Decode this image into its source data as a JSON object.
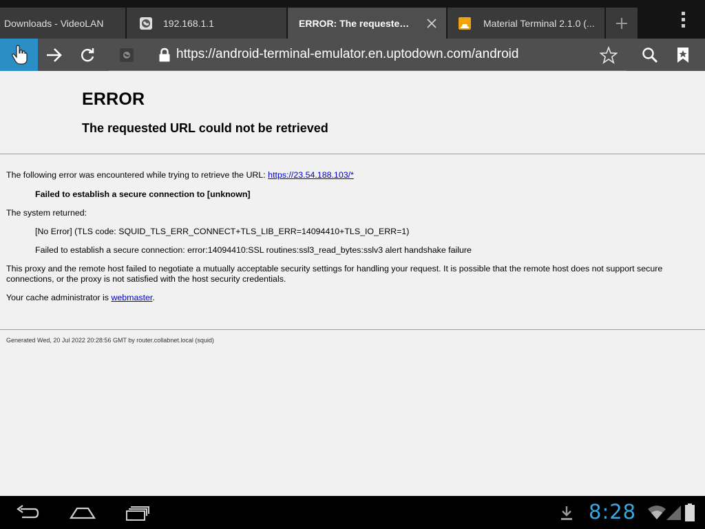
{
  "tabs": [
    {
      "title": "Downloads - VideoLAN",
      "favicon": "none",
      "active": false
    },
    {
      "title": "192.168.1.1",
      "favicon": "globe-icon",
      "active": false
    },
    {
      "title": "ERROR: The requested U...",
      "favicon": "none",
      "active": true
    },
    {
      "title": "Material Terminal 2.1.0 (...",
      "favicon": "vlc-cone-icon",
      "active": false
    }
  ],
  "toolbar": {
    "url": "https://android-terminal-emulator.en.uptodown.com/android"
  },
  "page": {
    "title": "ERROR",
    "subtitle": "The requested URL could not be retrieved",
    "intro_prefix": "The following error was encountered while trying to retrieve the URL: ",
    "intro_link": "https://23.54.188.103/*",
    "failure": "Failed to establish a secure connection to [unknown]",
    "system_returned": "The system returned:",
    "no_error": "[No Error] (TLS code: SQUID_TLS_ERR_CONNECT+TLS_LIB_ERR=14094410+TLS_IO_ERR=1)",
    "ssl_error": "Failed to establish a secure connection: error:14094410:SSL routines:ssl3_read_bytes:sslv3 alert handshake failure",
    "explanation": "This proxy and the remote host failed to negotiate a mutually acceptable security settings for handling your request. It is possible that the remote host does not support secure connections, or the proxy is not satisfied with the host security credentials.",
    "admin_prefix": "Your cache administrator is ",
    "admin_link": "webmaster",
    "admin_suffix": ".",
    "footer": "Generated Wed, 20 Jul 2022 20:28:56 GMT by router.collabnet.local (squid)"
  },
  "statusbar": {
    "clock": "8:28"
  },
  "colors": {
    "accent": "#2b8fc6",
    "clock": "#3aa7e0",
    "link": "#0000cc"
  }
}
